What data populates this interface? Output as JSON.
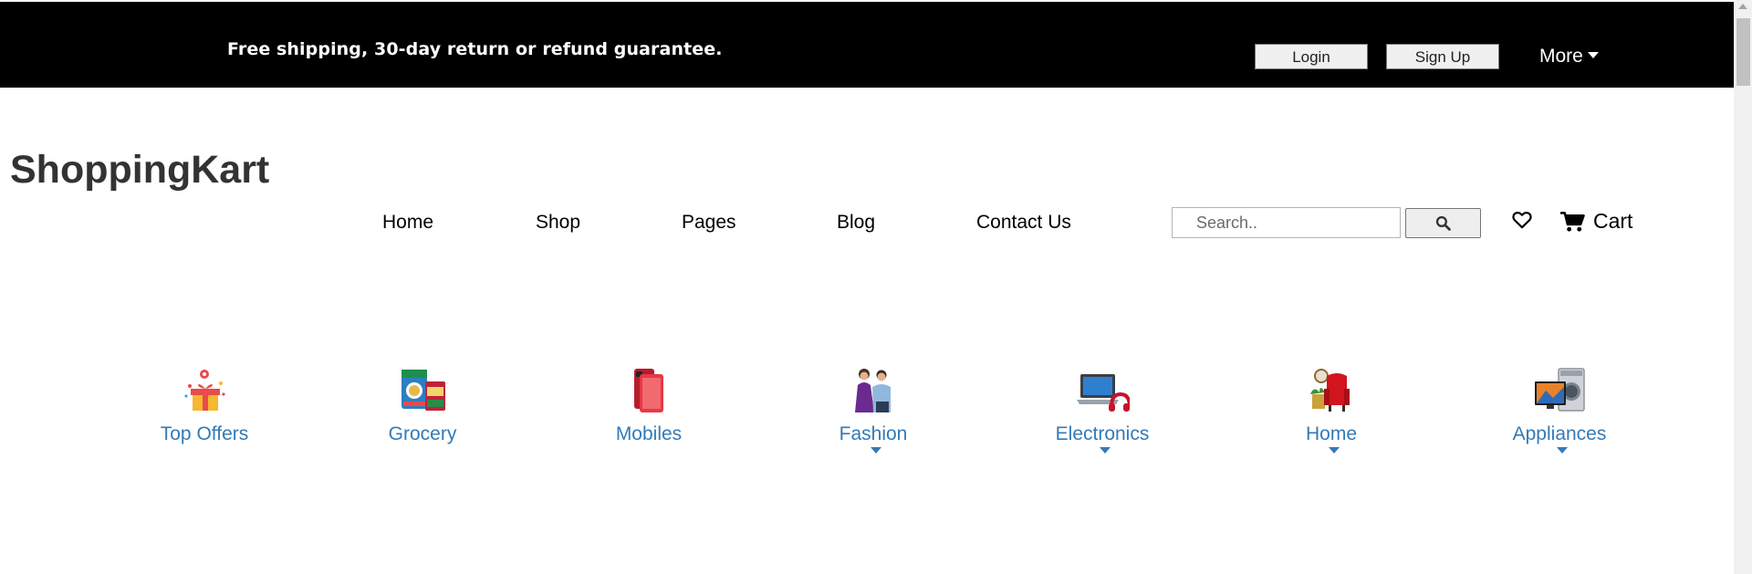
{
  "topbar": {
    "promo_text": "Free shipping, 30-day return or refund guarantee.",
    "login_label": "Login",
    "signup_label": "Sign Up",
    "more_label": "More",
    "background": "#000000"
  },
  "header": {
    "brand": "ShoppingKart",
    "nav": [
      "Home",
      "Shop",
      "Pages",
      "Blog",
      "Contact Us"
    ],
    "search_placeholder": "Search..",
    "search_icon": "search-icon",
    "wishlist_icon": "heart-icon",
    "cart_icon": "shopping-cart-icon",
    "cart_label": "Cart"
  },
  "categories": [
    {
      "label": "Top Offers",
      "icon": "gift-icon",
      "dropdown": false
    },
    {
      "label": "Grocery",
      "icon": "grocery-icon",
      "dropdown": false
    },
    {
      "label": "Mobiles",
      "icon": "mobile-phone-icon",
      "dropdown": false
    },
    {
      "label": "Fashion",
      "icon": "fashion-icon",
      "dropdown": true
    },
    {
      "label": "Electronics",
      "icon": "laptop-icon",
      "dropdown": true
    },
    {
      "label": "Home",
      "icon": "home-furniture-icon",
      "dropdown": true
    },
    {
      "label": "Appliances",
      "icon": "appliances-icon",
      "dropdown": true
    }
  ],
  "colors": {
    "category_link": "#337ab7",
    "brand_text": "#333333"
  }
}
